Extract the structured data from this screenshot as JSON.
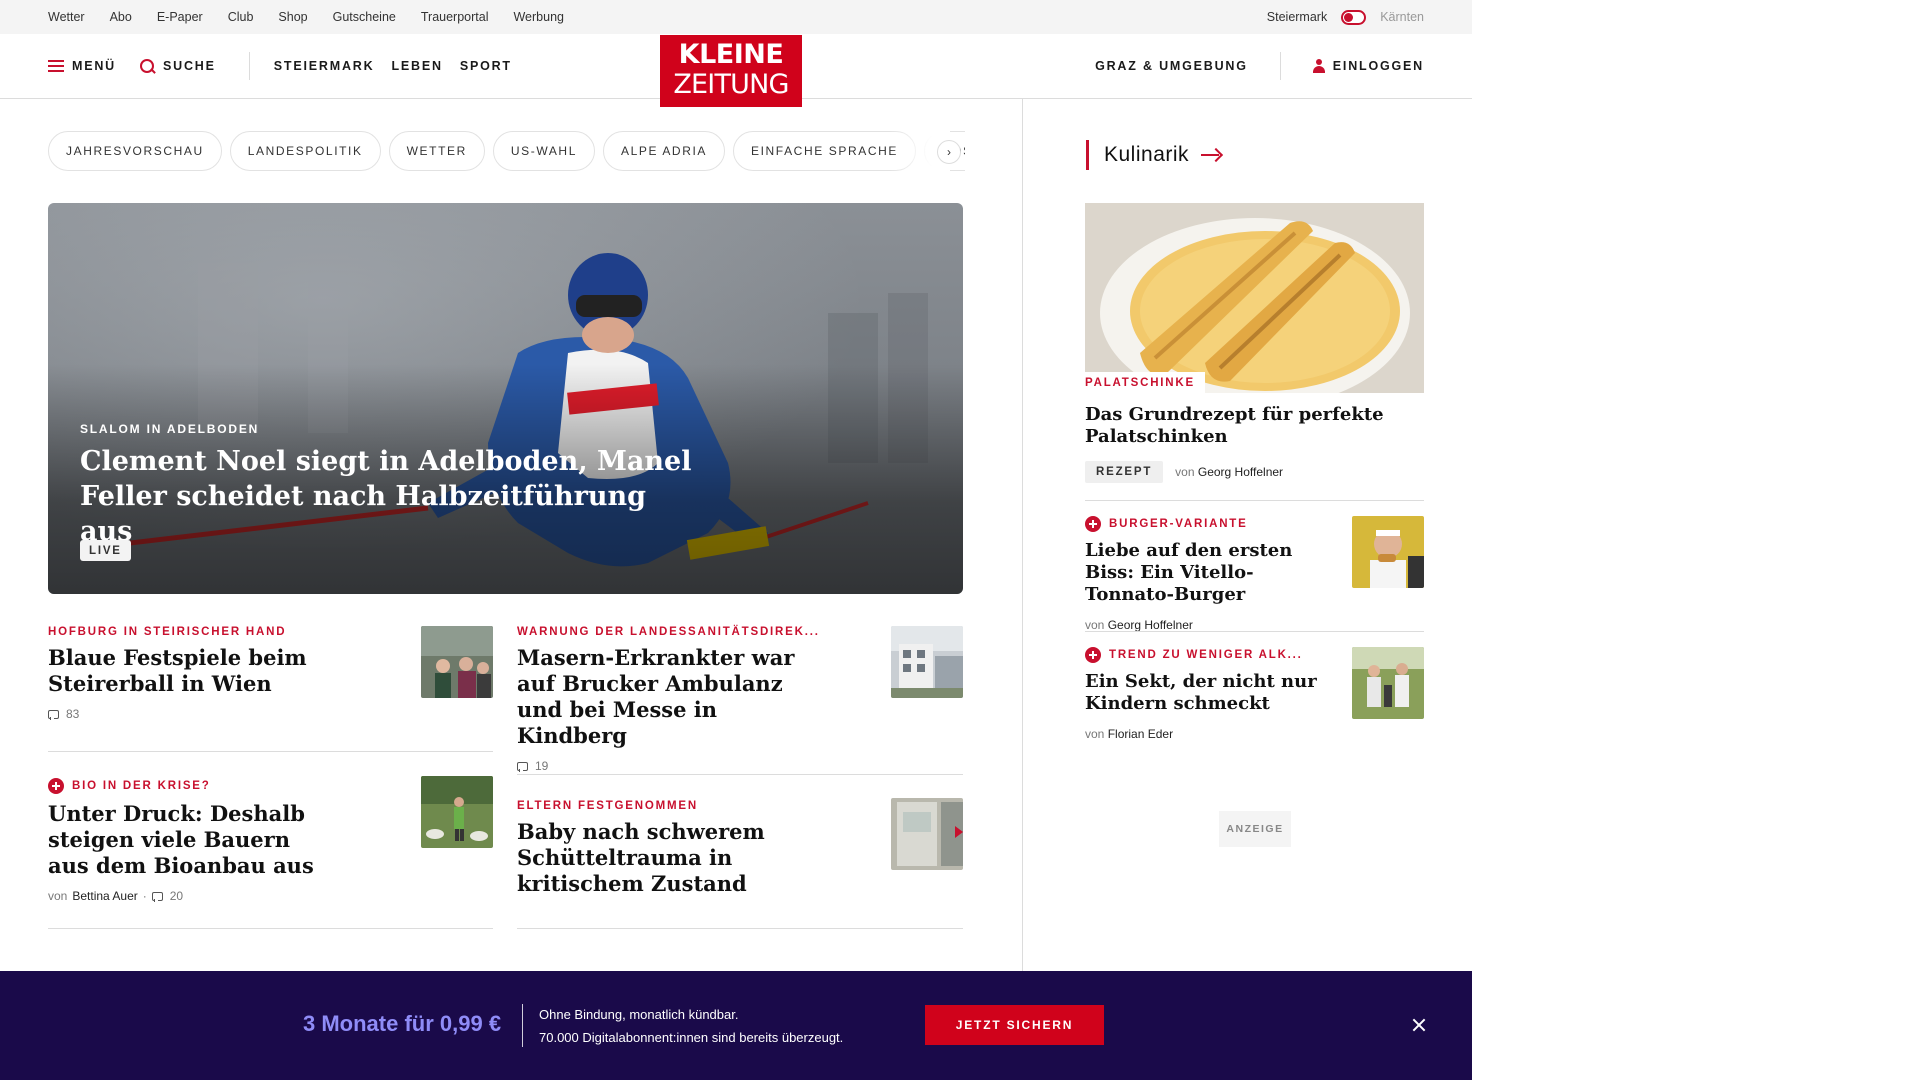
{
  "utility_bar": {
    "links": [
      "Wetter",
      "Abo",
      "E-Paper",
      "Club",
      "Shop",
      "Gutscheine",
      "Trauerportal",
      "Werbung"
    ],
    "region_active": "Steiermark",
    "region_inactive": "Kärnten"
  },
  "header": {
    "menu_label": "MENÜ",
    "search_label": "SUCHE",
    "sections": [
      "STEIERMARK",
      "LEBEN",
      "SPORT"
    ],
    "logo_line1": "KLEINE",
    "logo_line2": "ZEITUNG",
    "region_link": "GRAZ & UMGEBUNG",
    "login_label": "EINLOGGEN"
  },
  "topic_chips": [
    "JAHRESVORSCHAU",
    "LANDESPOLITIK",
    "WETTER",
    "US-WAHL",
    "ALPE ADRIA",
    "EINFACHE SPRACHE",
    "DOSSIER"
  ],
  "hero": {
    "kicker": "SLALOM IN ADELBODEN",
    "title": "Clement Noel siegt in Adelboden, Manel Feller scheidet nach Halbzeitführung aus",
    "badge": "LIVE"
  },
  "articles": [
    {
      "kicker": "HOFBURG IN STEIRISCHER HAND",
      "title": "Blaue Festspiele beim Steirerball in Wien",
      "comments": "83"
    },
    {
      "kicker": "WARNUNG DER LANDESSANITÄTSDIREK...",
      "title": "Masern-Erkrankter war auf Brucker Ambulanz und bei Messe in Kindberg",
      "comments": "19"
    },
    {
      "kicker": "BIO IN DER KRISE?",
      "title": "Unter Druck: Deshalb steigen viele Bauern aus dem Bioanbau aus",
      "byline_prefix": "von",
      "author": "Bettina Auer",
      "comments": "20"
    },
    {
      "kicker": "ELTERN FESTGENOMMEN",
      "title": "Baby nach schwerem Schütteltrauma in kritischem Zustand"
    }
  ],
  "sidebar": {
    "section_title": "Kulinarik",
    "feature": {
      "tag": "PALATSCHINKE",
      "title": "Das Grundrezept für perfekte Palatschinken",
      "badge": "REZEPT",
      "byline_prefix": "von",
      "author": "Georg Hoffelner"
    },
    "teasers": [
      {
        "kicker": "BURGER-VARIANTE",
        "title": "Liebe auf den ersten Biss: Ein Vitello-Tonnato-Burger",
        "byline_prefix": "von",
        "author": "Georg Hoffelner"
      },
      {
        "kicker": "TREND ZU WENIGER ALK...",
        "title": "Ein Sekt, der nicht nur Kindern schmeckt",
        "byline_prefix": "von",
        "author": "Florian Eder"
      }
    ],
    "ad_label": "ANZEIGE"
  },
  "promo": {
    "price": "3 Monate für 0,99 €",
    "line1": "Ohne Bindung, monatlich kündbar.",
    "line2": "70.000 Digitalabonnent:innen sind bereits überzeugt.",
    "button": "JETZT SICHERN"
  },
  "colors": {
    "brand_red": "#d0021b",
    "promo_bg": "#1a0a4a",
    "promo_price": "#8f8cf7"
  }
}
